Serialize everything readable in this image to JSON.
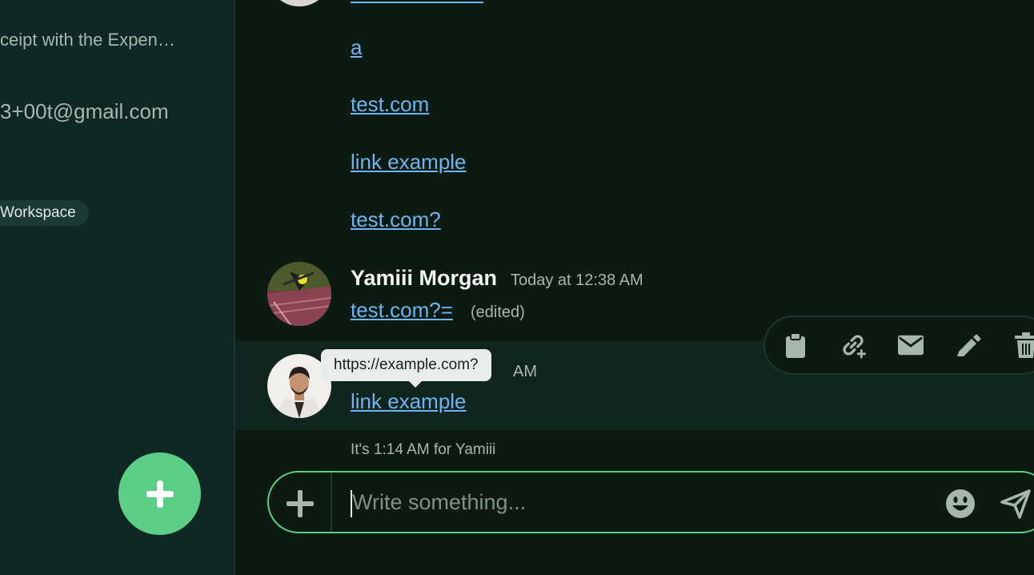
{
  "sidebar": {
    "preview_text": "ceipt with the Expen…",
    "email_text": "3+00t@gmail.com",
    "workspace_badge": "Workspace"
  },
  "chat": {
    "prev_links": [
      "a",
      "test.com",
      "link example",
      "test.com?"
    ],
    "message1": {
      "author": "Yamiii Morgan",
      "timestamp": "Today at 12:38 AM",
      "link": "test.com?=",
      "edited": "(edited)"
    },
    "message2": {
      "timestamp_fragment": "AM",
      "link": "link example"
    },
    "tooltip": "https://example.com?",
    "local_time": "It's 1:14 AM for Yamiii"
  },
  "composer": {
    "placeholder": "Write something..."
  },
  "actions": [
    "clipboard-icon",
    "link-add-icon",
    "mail-icon",
    "pencil-icon",
    "trash-icon"
  ],
  "colors": {
    "accent": "#5cce87",
    "link": "#6fb4f2",
    "background": "#0b1b11",
    "sidebar": "#102823"
  }
}
